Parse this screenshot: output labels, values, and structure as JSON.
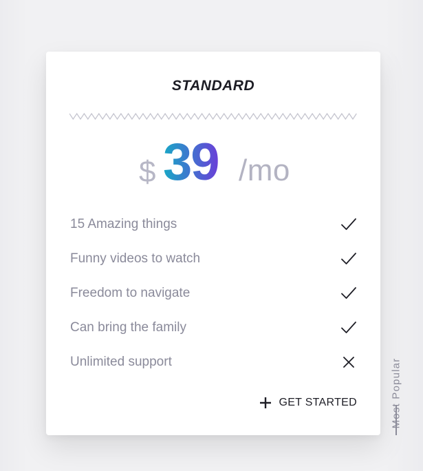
{
  "plan": {
    "name": "STANDARD",
    "price": {
      "currency": "$",
      "amount": "39",
      "period": "/mo"
    },
    "features": [
      {
        "label": "15 Amazing things",
        "included": true,
        "icon": "check-icon"
      },
      {
        "label": "Funny videos to watch",
        "included": true,
        "icon": "check-icon"
      },
      {
        "label": "Freedom to navigate",
        "included": true,
        "icon": "check-icon"
      },
      {
        "label": "Can bring the family",
        "included": true,
        "icon": "check-icon"
      },
      {
        "label": "Unlimited support",
        "included": false,
        "icon": "cross-icon"
      }
    ],
    "cta": {
      "label": "GET STARTED",
      "icon": "plus-icon"
    },
    "badge": "Most Popular"
  },
  "colors": {
    "price_gradient_start": "#18a8c6",
    "price_gradient_end": "#6a3fd8",
    "feature_text": "#8a8a9a",
    "title": "#1c1c24",
    "muted": "#b3b3c2"
  }
}
